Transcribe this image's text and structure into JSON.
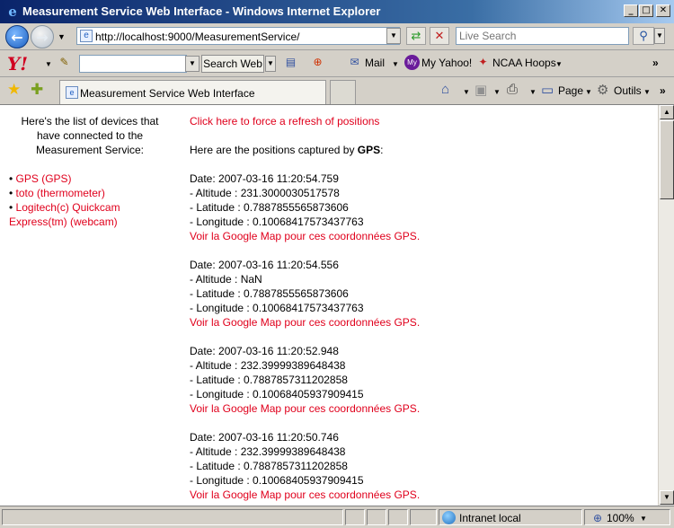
{
  "window": {
    "title": "Measurement Service Web Interface - Windows Internet Explorer",
    "min_glyph": "_",
    "max_glyph": "□",
    "close_glyph": "✕"
  },
  "address": {
    "url": "http://localhost:9000/MeasurementService/",
    "search_placeholder": "Live Search"
  },
  "yahoo": {
    "logo": "Y!",
    "search_button": "Search Web",
    "mail": "Mail",
    "my_yahoo": "My Yahoo!",
    "ncaa": "NCAA Hoops",
    "overflow": "»"
  },
  "tabs": {
    "active_label": "Measurement Service Web Interface"
  },
  "commands": {
    "page": "Page",
    "tools": "Outils",
    "overflow": "»"
  },
  "content": {
    "intro": "Here's the list of devices that have connected to the Measurement Service:",
    "devices": [
      {
        "label": "GPS (GPS)"
      },
      {
        "label": "toto (thermometer)"
      },
      {
        "label": "Logitech(c) Quickcam Express(tm) (webcam)"
      }
    ],
    "refresh_link": "Click here to force a refresh of positions",
    "positions_prefix": "Here are the positions captured by ",
    "positions_device": "GPS",
    "positions_suffix": ":",
    "records": [
      {
        "date": "Date: 2007-03-16 11:20:54.759",
        "altitude": "- Altitude : 231.3000030517578",
        "latitude": "- Latitude : 0.7887855565873606",
        "longitude": "- Longitude : 0.10068417573437763",
        "map_link": "Voir la Google Map pour ces coordonnées GPS."
      },
      {
        "date": "Date: 2007-03-16 11:20:54.556",
        "altitude": "- Altitude : NaN",
        "latitude": "- Latitude : 0.7887855565873606",
        "longitude": "- Longitude : 0.10068417573437763",
        "map_link": "Voir la Google Map pour ces coordonnées GPS."
      },
      {
        "date": "Date: 2007-03-16 11:20:52.948",
        "altitude": "- Altitude : 232.39999389648438",
        "latitude": "- Latitude : 0.7887857311202858",
        "longitude": "- Longitude : 0.10068405937909415",
        "map_link": "Voir la Google Map pour ces coordonnées GPS."
      },
      {
        "date": "Date: 2007-03-16 11:20:50.746",
        "altitude": "- Altitude : 232.39999389648438",
        "latitude": "- Latitude : 0.7887857311202858",
        "longitude": "- Longitude : 0.10068405937909415",
        "map_link": "Voir la Google Map pour ces coordonnées GPS."
      }
    ]
  },
  "status": {
    "zone": "Intranet local",
    "zoom": "100%"
  },
  "colors": {
    "link": "#e0001c",
    "title_bar": "#0a246a"
  }
}
